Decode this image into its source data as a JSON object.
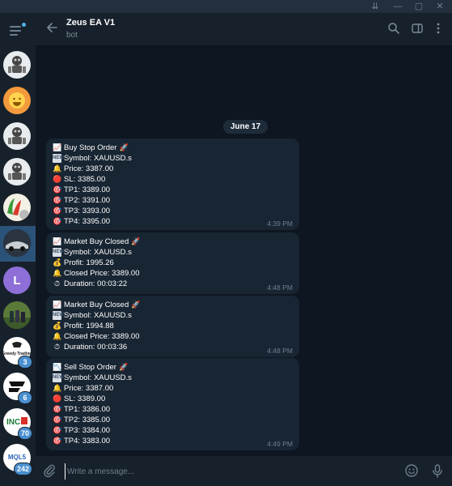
{
  "window": {
    "controls": [
      "⇊",
      "—",
      "▢",
      "✕"
    ]
  },
  "header": {
    "title": "Zeus EA V1",
    "subtitle": "bot"
  },
  "sidebar": {
    "chats": [
      {
        "kind": "robot",
        "badge": ""
      },
      {
        "kind": "smiley",
        "badge": ""
      },
      {
        "kind": "robot",
        "badge": ""
      },
      {
        "kind": "robot",
        "badge": ""
      },
      {
        "kind": "flag",
        "badge": ""
      },
      {
        "kind": "photo-dark",
        "badge": "",
        "active": true
      },
      {
        "kind": "letter",
        "letter": "L",
        "badge": ""
      },
      {
        "kind": "photo-people",
        "badge": ""
      },
      {
        "kind": "logo-text",
        "text": "Greedy Trading",
        "badge": "3"
      },
      {
        "kind": "logo-shape",
        "badge": "6"
      },
      {
        "kind": "logo-inc",
        "text": "INC",
        "badge": "70"
      },
      {
        "kind": "logo-mql5",
        "text": "MQL5",
        "badge": "242"
      }
    ]
  },
  "chat": {
    "date": "June 17",
    "messages": [
      {
        "time": "4:39 PM",
        "lines": [
          {
            "icon": "📈",
            "text": "Buy Stop Order",
            "trail": "🚀"
          },
          {
            "icon": "NEW",
            "text": "Symbol: XAUUSD.s"
          },
          {
            "icon": "🔔",
            "text": "Price: 3387.00"
          },
          {
            "icon": "🔴",
            "text": "SL: 3385.00"
          },
          {
            "icon": "🎯",
            "text": "TP1: 3389.00"
          },
          {
            "icon": "🎯",
            "text": "TP2: 3391.00"
          },
          {
            "icon": "🎯",
            "text": "TP3: 3393.00"
          },
          {
            "icon": "🎯",
            "text": "TP4: 3395.00"
          }
        ]
      },
      {
        "time": "4:48 PM",
        "lines": [
          {
            "icon": "📈",
            "text": "Market Buy Closed",
            "trail": "🚀"
          },
          {
            "icon": "NEW",
            "text": "Symbol: XAUUSD.s"
          },
          {
            "icon": "💰",
            "text": "Profit: 1995.26"
          },
          {
            "icon": "🔔",
            "text": "Closed Price: 3389.00"
          },
          {
            "icon": "⏱",
            "text": "Duration: 00:03:22"
          }
        ]
      },
      {
        "time": "4:48 PM",
        "lines": [
          {
            "icon": "📈",
            "text": "Market Buy Closed",
            "trail": "🚀"
          },
          {
            "icon": "NEW",
            "text": "Symbol: XAUUSD.s"
          },
          {
            "icon": "💰",
            "text": "Profit: 1994.88"
          },
          {
            "icon": "🔔",
            "text": "Closed Price: 3389.00"
          },
          {
            "icon": "⏱",
            "text": "Duration: 00:03:36"
          }
        ]
      },
      {
        "time": "4:49 PM",
        "lines": [
          {
            "icon": "📉",
            "text": "Sell Stop Order",
            "trail": "🚀"
          },
          {
            "icon": "NEW",
            "text": "Symbol: XAUUSD.s"
          },
          {
            "icon": "🔔",
            "text": "Price: 3387.00"
          },
          {
            "icon": "🔴",
            "text": "SL: 3389.00"
          },
          {
            "icon": "🎯",
            "text": "TP1: 3386.00"
          },
          {
            "icon": "🎯",
            "text": "TP2: 3385.00"
          },
          {
            "icon": "🎯",
            "text": "TP3: 3384.00"
          },
          {
            "icon": "🎯",
            "text": "TP4: 3383.00"
          }
        ]
      }
    ]
  },
  "composer": {
    "placeholder": "Write a message..."
  },
  "colors": {
    "background": "#0e1621",
    "panel": "#17212b",
    "bubble": "#182533",
    "accent": "#2b5278",
    "badge": "#4a8fd0"
  }
}
